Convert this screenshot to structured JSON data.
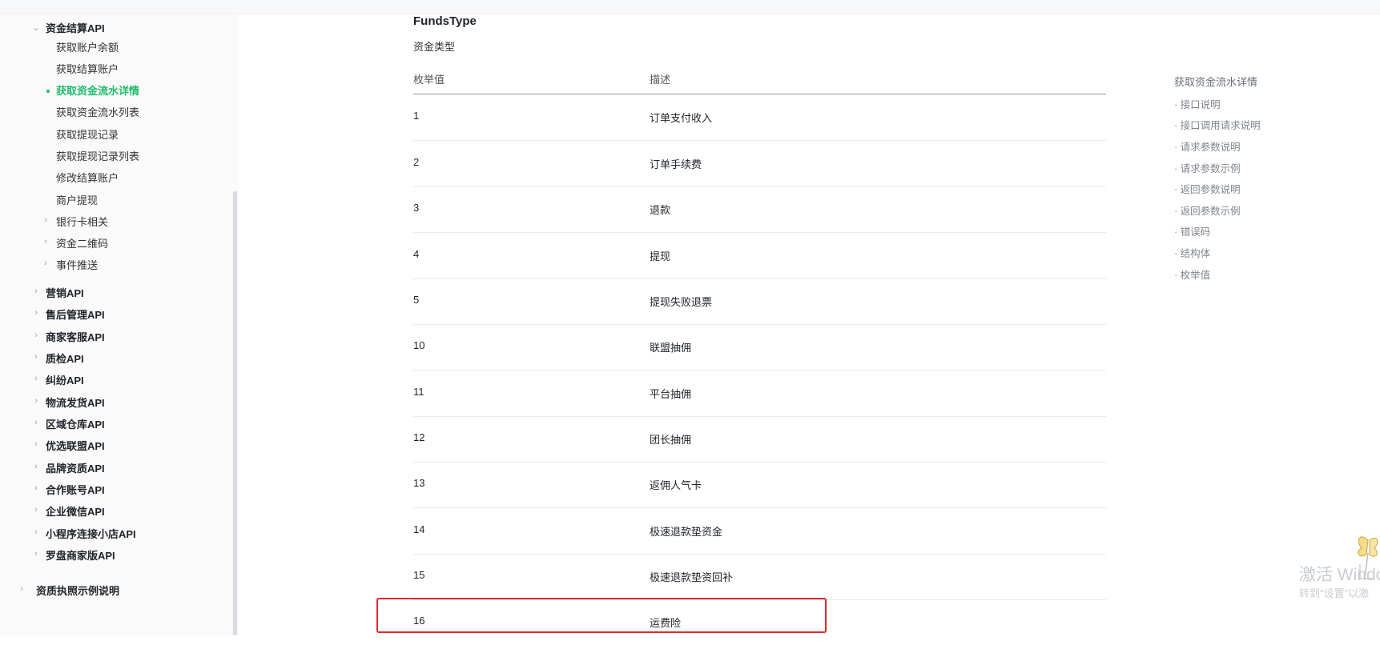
{
  "sidebar": {
    "section_expanded": "资金结算API",
    "children": [
      "获取账户余额",
      "获取结算账户",
      "获取资金流水详情",
      "获取资金流水列表",
      "获取提现记录",
      "获取提现记录列表",
      "修改结算账户",
      "商户提现"
    ],
    "active_child": "获取资金流水详情",
    "sub_groups": [
      "银行卡相关",
      "资金二维码",
      "事件推送"
    ],
    "groups": [
      "营销API",
      "售后管理API",
      "商家客服API",
      "质检API",
      "纠纷API",
      "物流发货API",
      "区域仓库API",
      "优选联盟API",
      "品牌资质API",
      "合作账号API",
      "企业微信API",
      "小程序连接小店API",
      "罗盘商家版API"
    ],
    "bottom_group": "资质执照示例说明"
  },
  "content": {
    "title": "FundsType",
    "subtitle": "资金类型",
    "table": {
      "headers": [
        "枚举值",
        "描述"
      ],
      "rows": [
        [
          "1",
          "订单支付收入"
        ],
        [
          "2",
          "订单手续费"
        ],
        [
          "3",
          "退款"
        ],
        [
          "4",
          "提现"
        ],
        [
          "5",
          "提现失败退票"
        ],
        [
          "10",
          "联盟抽佣"
        ],
        [
          "11",
          "平台抽佣"
        ],
        [
          "12",
          "团长抽佣"
        ],
        [
          "13",
          "返佣人气卡"
        ],
        [
          "14",
          "极速退款垫资金"
        ],
        [
          "15",
          "极速退款垫资回补"
        ],
        [
          "16",
          "运费险"
        ]
      ],
      "highlighted_row": "16"
    }
  },
  "toc": {
    "title": "获取资金流水详情",
    "items": [
      "· 接口说明",
      "· 接口调用请求说明",
      "· 请求参数说明",
      "· 请求参数示例",
      "· 返回参数说明",
      "· 返回参数示例",
      "· 错误码",
      "· 结构体",
      "· 枚举值"
    ]
  },
  "watermark": {
    "line1": "激活 Windo",
    "line2": "转到\"设置\"以激"
  },
  "colors": {
    "accent_green": "#1dbb6b",
    "highlight_red": "#e02828"
  }
}
